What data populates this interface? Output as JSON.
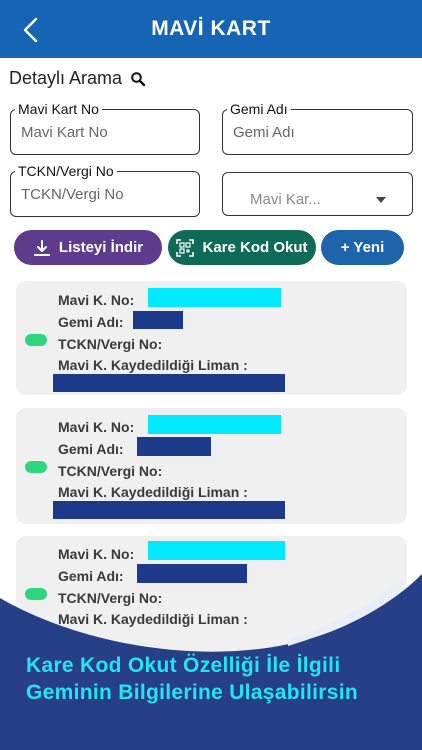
{
  "header": {
    "title": "MAVİ KART"
  },
  "search": {
    "label": "Detaylı Arama"
  },
  "fields": {
    "mavi_kart_no": {
      "label": "Mavi Kart No",
      "placeholder": "Mavi Kart No"
    },
    "gemi_adi": {
      "label": "Gemi Adı",
      "placeholder": "Gemi Adı"
    },
    "tckn": {
      "label": "TCKN/Vergi No",
      "placeholder": "TCKN/Vergi No"
    },
    "select": {
      "value": "Mavi Kar..."
    }
  },
  "buttons": {
    "download": "Listeyi İndir",
    "qr": "Kare Kod Okut",
    "new": "+ Yeni"
  },
  "card_labels": {
    "no": "Mavi K. No:",
    "gemi": "Gemi Adı:",
    "tckn": "TCKN/Vergi No:",
    "liman": "Mavi K. Kaydedildiği Liman :"
  },
  "colors": {
    "header": "#1565b4",
    "status_dot": "#2ed67f",
    "redacted_cyan": "#00e9ff",
    "redacted_navy": "#1d3a8a",
    "banner": "#273f86",
    "banner_text": "#22e4f2"
  },
  "banner": {
    "text": "Kare Kod Okut Özelliği İle İlgili Geminin Bilgilerine Ulaşabilirsin"
  }
}
